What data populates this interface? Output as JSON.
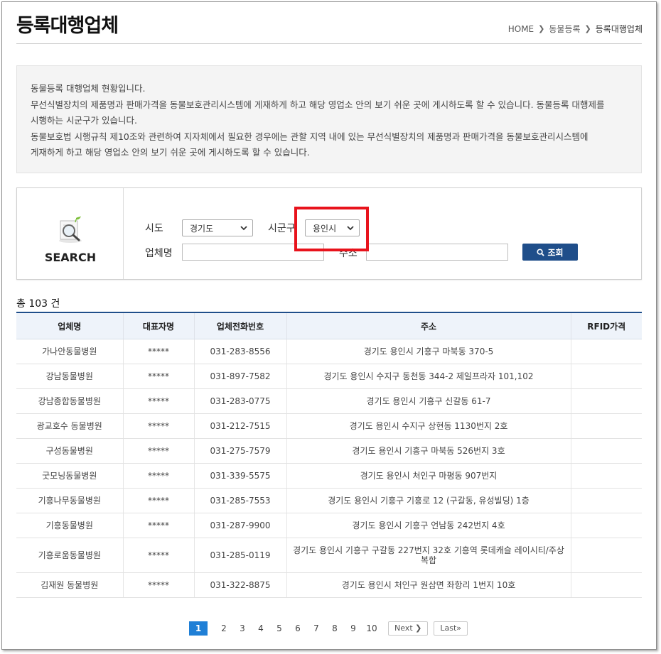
{
  "page": {
    "title": "등록대행업체",
    "breadcrumb": [
      "HOME",
      "동물등록",
      "등록대행업체"
    ]
  },
  "notice": {
    "lines": [
      "동물등록 대행업체 현황입니다.",
      "무선식별장치의 제품명과 판매가격을 동물보호관리시스템에 게재하게 하고 해당 영업소 안의 보기 쉬운 곳에 게시하도록 할 수 있습니다. 동물등록 대행제를",
      "시행하는 시군구가 있습니다.",
      "동물보호법 시행규칙 제10조와 관련하여 지자체에서 필요한 경우에는 관할 지역 내에 있는 무선식별장치의 제품명과 판매가격을 동물보호관리시스템에",
      "게재하게 하고 해당 영업소 안의 보기 쉬운 곳에 게시하도록 할 수 있습니다."
    ]
  },
  "search": {
    "icon": "magnifier-document-icon",
    "label": "SEARCH",
    "sido_label": "시도",
    "sido_value": "경기도",
    "sigungu_label": "시군구",
    "sigungu_value": "용인시",
    "company_label": "업체명",
    "company_value": "",
    "address_label": "주소",
    "address_value": "",
    "button_label": "조회"
  },
  "summary": {
    "total": "총 103 건"
  },
  "table": {
    "headers": [
      "업체명",
      "대표자명",
      "업체전화번호",
      "주소",
      "RFID가격"
    ],
    "rows": [
      [
        "가나안동물병원",
        "*****",
        "031-283-8556",
        "경기도 용인시 기흥구 마북동 370-5",
        ""
      ],
      [
        "강남동물병원",
        "*****",
        "031-897-7582",
        "경기도 용인시 수지구 동천동 344-2 제일프라자 101,102",
        ""
      ],
      [
        "강남종합동물병원",
        "*****",
        "031-283-0775",
        "경기도 용인시 기흥구 신갈동 61-7",
        ""
      ],
      [
        "광교호수 동물병원",
        "*****",
        "031-212-7515",
        "경기도 용인시 수지구 상현동 1130번지 2호",
        ""
      ],
      [
        "구성동물병원",
        "*****",
        "031-275-7579",
        "경기도 용인시 기흥구 마북동 526번지 3호",
        ""
      ],
      [
        "굿모닝동물병원",
        "*****",
        "031-339-5575",
        "경기도 용인시 처인구 마평동 907번지",
        ""
      ],
      [
        "기흥나무동물병원",
        "*****",
        "031-285-7553",
        "경기도 용인시 기흥구 기흥로 12 (구갈동, 유성빌딩) 1층",
        ""
      ],
      [
        "기흥동물병원",
        "*****",
        "031-287-9900",
        "경기도 용인시 기흥구 언남동 242번지 4호",
        ""
      ],
      [
        "기흥로움동물병원",
        "*****",
        "031-285-0119",
        "경기도 용인시 기흥구 구갈동 227번지 32호 기흥역 롯데캐슬 레이시티/주상복합",
        ""
      ],
      [
        "김재원 동물병원",
        "*****",
        "031-322-8875",
        "경기도 용인시 처인구 원삼면 좌항리 1번지 10호",
        ""
      ]
    ]
  },
  "pagination": {
    "current": "1",
    "pages": [
      "2",
      "3",
      "4",
      "5",
      "6",
      "7",
      "8",
      "9",
      "10"
    ],
    "next_label": "Next",
    "last_label": "Last"
  },
  "colors": {
    "accent": "#1f4e8a",
    "highlight": "#e8131c",
    "active_page": "#1f7fd6"
  }
}
